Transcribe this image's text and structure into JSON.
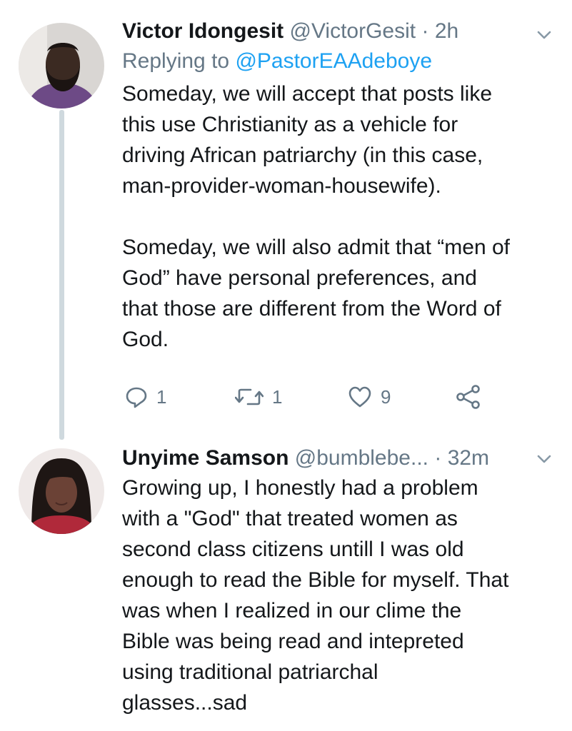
{
  "tweets": [
    {
      "name": "Victor Idongesit",
      "handle": "@VictorGesit",
      "separator": "·",
      "time": "2h",
      "replying_prefix": "Replying to ",
      "replying_to": "@PastorEAAdeboye",
      "text": "Someday, we will accept that posts like\nthis use Christianity as a vehicle for\ndriving African patriarchy (in this case,\nman-provider-woman-housewife).\n\nSomeday, we will also admit that “men of\nGod” have personal preferences, and\nthat those are different from the Word of\nGod.",
      "actions": {
        "reply_count": "1",
        "retweet_count": "1",
        "like_count": "9"
      }
    },
    {
      "name": "Unyime Samson",
      "handle": "@bumblebe...",
      "separator": "·",
      "time": "32m",
      "text": "Growing up, I honestly had a problem\nwith a \"God\" that treated women as\nsecond class citizens untill I was old\nenough to read the Bible for myself. That\nwas when I realized in our clime the\nBible was being read and intepreted\nusing traditional patriarchal\nglasses...sad"
    }
  ],
  "icons": {
    "reply": "reply-icon",
    "retweet": "retweet-icon",
    "like": "heart-icon",
    "share": "share-icon",
    "menu": "chevron-down-icon"
  },
  "colors": {
    "text": "#14171a",
    "muted": "#657786",
    "link": "#1da1f2",
    "thread_line": "#cfd9de"
  }
}
